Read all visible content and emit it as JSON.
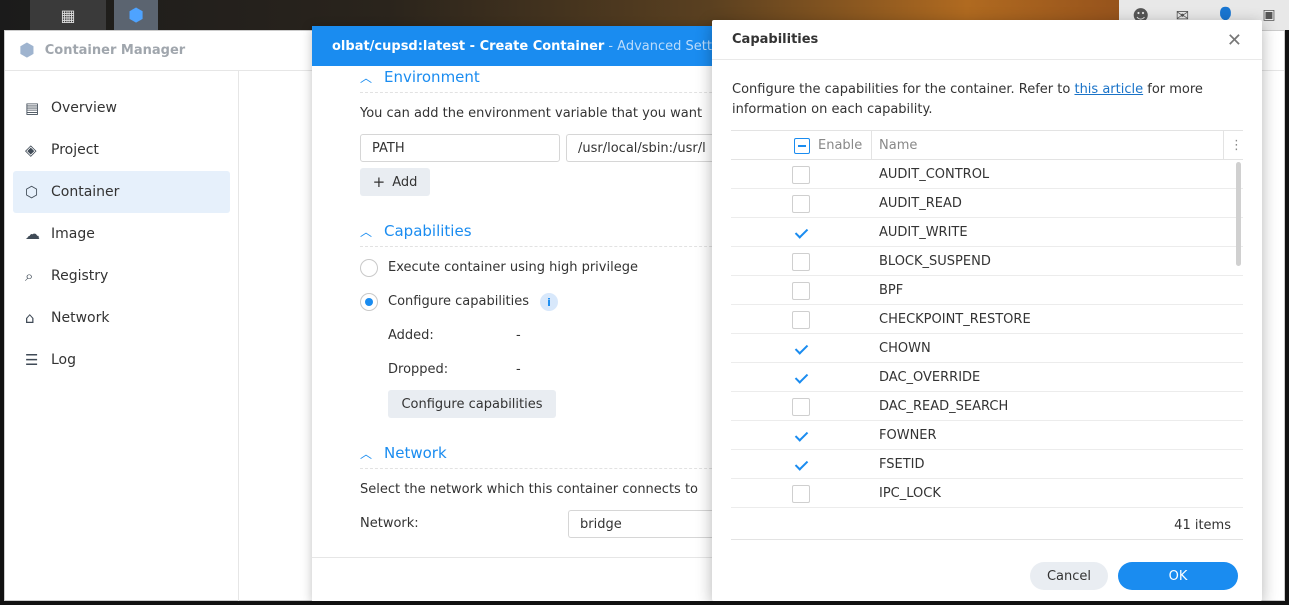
{
  "app": {
    "title": "Container Manager"
  },
  "sidebar": {
    "items": [
      {
        "label": "Overview",
        "icon": "overview-icon",
        "glyph": "▤"
      },
      {
        "label": "Project",
        "icon": "layers-icon",
        "glyph": "◈"
      },
      {
        "label": "Container",
        "icon": "cube-icon",
        "glyph": "⬡",
        "active": true
      },
      {
        "label": "Image",
        "icon": "cloud-icon",
        "glyph": "☁"
      },
      {
        "label": "Registry",
        "icon": "registry-icon",
        "glyph": "⌕"
      },
      {
        "label": "Network",
        "icon": "network-icon",
        "glyph": "⌂"
      },
      {
        "label": "Log",
        "icon": "log-icon",
        "glyph": "☰"
      }
    ]
  },
  "create_dialog": {
    "title": "olbat/cupsd:latest - Create Container",
    "subtitle": "- Advanced Settings",
    "environment": {
      "heading": "Environment",
      "description": "You can add the environment variable that you want",
      "var_name": "PATH",
      "var_value": "/usr/local/sbin:/usr/l",
      "add_label": "Add"
    },
    "capabilities": {
      "heading": "Capabilities",
      "option_high_privilege": "Execute container using high privilege",
      "option_configure": "Configure capabilities",
      "added_label": "Added:",
      "added_value": "-",
      "dropped_label": "Dropped:",
      "dropped_value": "-",
      "configure_button": "Configure capabilities"
    },
    "network": {
      "heading": "Network",
      "description": "Select the network which this container connects to",
      "label": "Network:",
      "value": "bridge"
    }
  },
  "cap_modal": {
    "title": "Capabilities",
    "desc_before": "Configure the capabilities for the container. Refer to ",
    "desc_link": "this article",
    "desc_after": " for more information on each capability.",
    "col_enable": "Enable",
    "col_name": "Name",
    "rows": [
      {
        "name": "AUDIT_CONTROL",
        "checked": false
      },
      {
        "name": "AUDIT_READ",
        "checked": false
      },
      {
        "name": "AUDIT_WRITE",
        "checked": true
      },
      {
        "name": "BLOCK_SUSPEND",
        "checked": false
      },
      {
        "name": "BPF",
        "checked": false
      },
      {
        "name": "CHECKPOINT_RESTORE",
        "checked": false
      },
      {
        "name": "CHOWN",
        "checked": true
      },
      {
        "name": "DAC_OVERRIDE",
        "checked": true
      },
      {
        "name": "DAC_READ_SEARCH",
        "checked": false
      },
      {
        "name": "FOWNER",
        "checked": true
      },
      {
        "name": "FSETID",
        "checked": true
      },
      {
        "name": "IPC_LOCK",
        "checked": false
      }
    ],
    "count": "41 items",
    "cancel_label": "Cancel",
    "ok_label": "OK"
  },
  "colors": {
    "accent": "#1a8cf0",
    "header_blue": "#1a8cf0"
  }
}
